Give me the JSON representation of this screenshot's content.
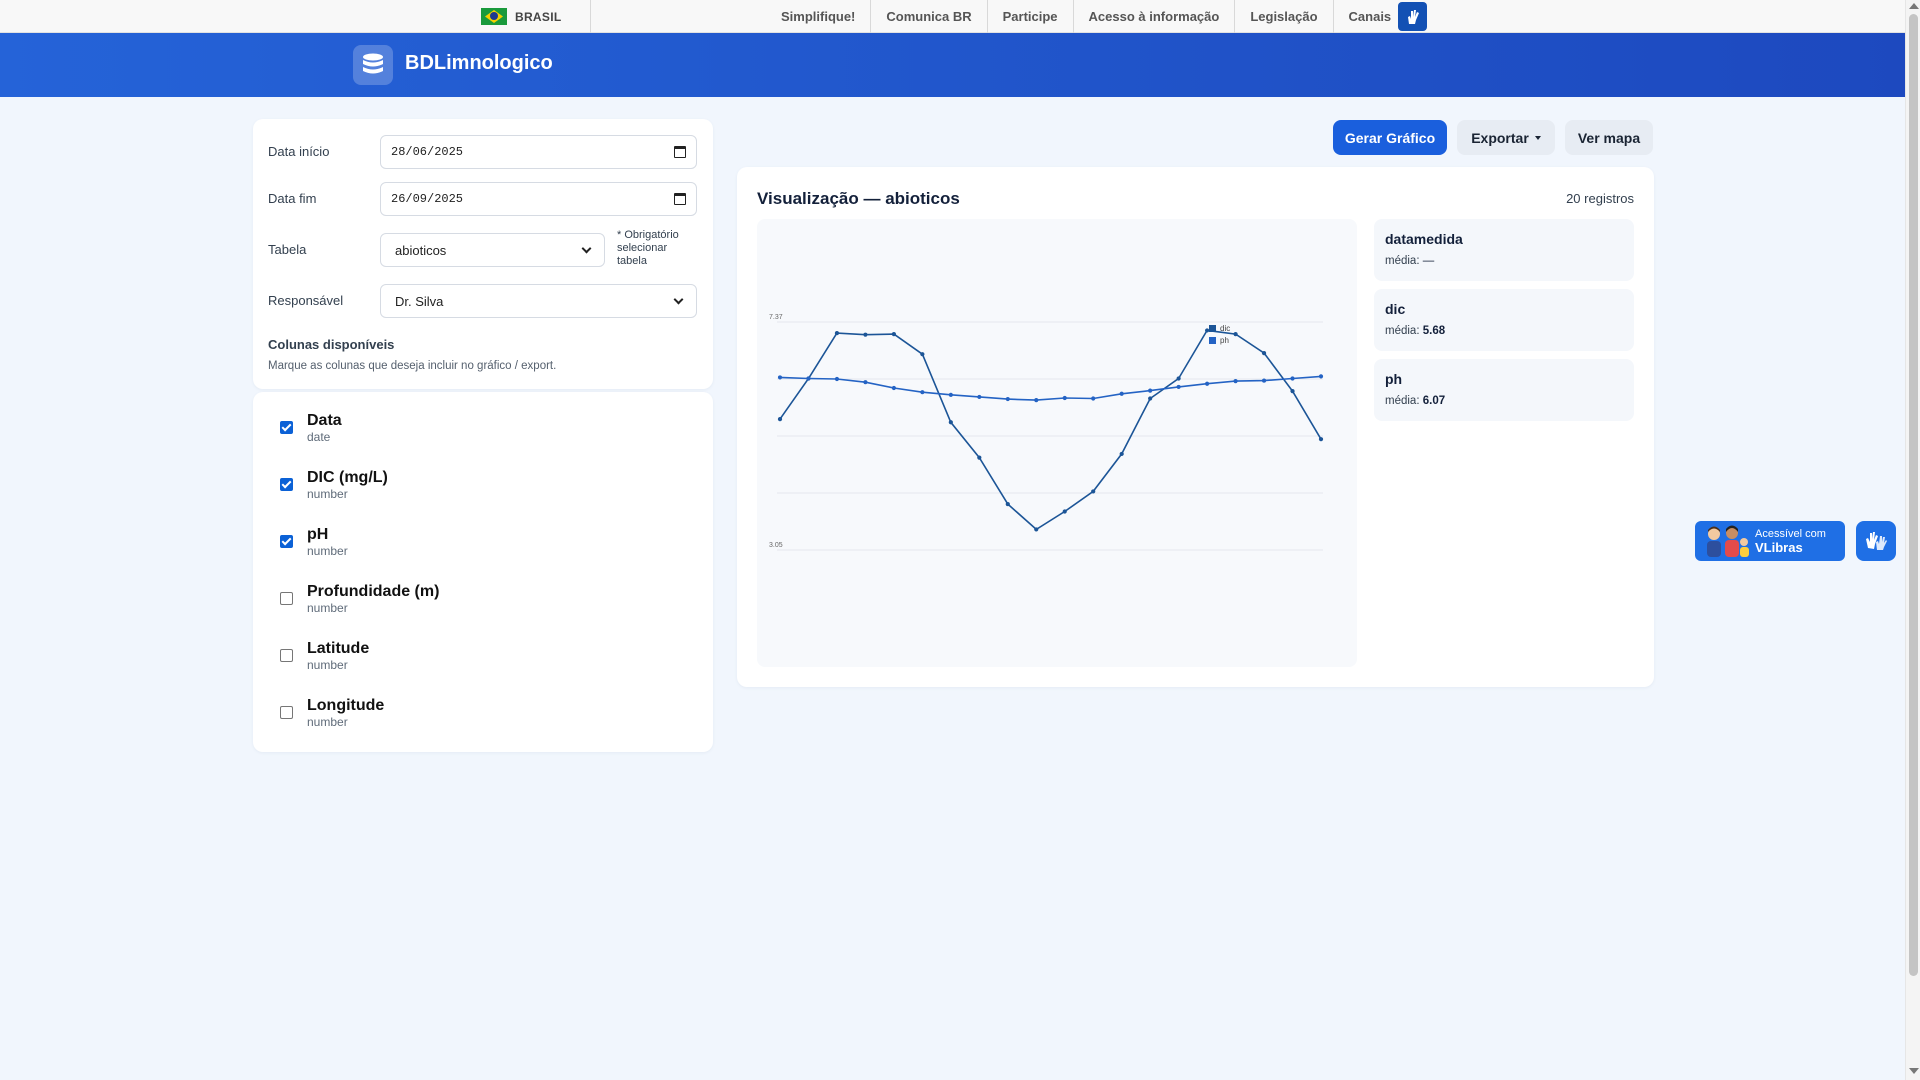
{
  "govbar": {
    "country": "BRASIL",
    "links": [
      "Simplifique!",
      "Comunica BR",
      "Participe",
      "Acesso à informação",
      "Legislação",
      "Canais"
    ]
  },
  "header": {
    "title": "BDLimnologico"
  },
  "filters": {
    "start_label": "Data início",
    "start_value": "28/06/2025",
    "end_label": "Data fim",
    "end_value": "26/09/2025",
    "table_label": "Tabela",
    "table_value": "abioticos",
    "required_note": "* Obrigatório selecionar tabela",
    "responsible_label": "Responsável",
    "responsible_value": "Dr. Silva",
    "columns_title": "Colunas disponíveis",
    "columns_subtitle": "Marque as colunas que deseja incluir no gráfico / export."
  },
  "columns": [
    {
      "name": "Data",
      "type": "date",
      "checked": true
    },
    {
      "name": "DIC (mg/L)",
      "type": "number",
      "checked": true
    },
    {
      "name": "pH",
      "type": "number",
      "checked": true
    },
    {
      "name": "Profundidade (m)",
      "type": "number",
      "checked": false
    },
    {
      "name": "Latitude",
      "type": "number",
      "checked": false
    },
    {
      "name": "Longitude",
      "type": "number",
      "checked": false
    }
  ],
  "toolbar": {
    "generate": "Gerar Gráfico",
    "export": "Exportar",
    "map": "Ver mapa"
  },
  "chart_panel": {
    "title": "Visualização — abioticos",
    "count": "20 registros",
    "stats": [
      {
        "name": "datamedida",
        "label": "média:",
        "value": "—"
      },
      {
        "name": "dic",
        "label": "média:",
        "value": "5.68"
      },
      {
        "name": "ph",
        "label": "média:",
        "value": "6.07"
      }
    ]
  },
  "chart_data": {
    "type": "line",
    "title": "",
    "xlabel": "",
    "ylabel": "",
    "ylim": [
      3.05,
      7.37
    ],
    "ytick_labels": [
      "7.37",
      "3.05"
    ],
    "x": [
      1,
      2,
      3,
      4,
      5,
      6,
      7,
      8,
      9,
      10,
      11,
      12,
      13,
      14,
      15,
      16,
      17,
      18,
      19,
      20
    ],
    "series": [
      {
        "name": "dic",
        "color": "#1c5597",
        "values": [
          5.53,
          6.3,
          7.16,
          7.13,
          7.14,
          6.76,
          5.47,
          4.8,
          3.92,
          3.44,
          3.78,
          4.16,
          4.87,
          5.92,
          6.3,
          7.21,
          7.14,
          6.78,
          6.06,
          5.15
        ]
      },
      {
        "name": "ph",
        "color": "#2463c4",
        "values": [
          6.32,
          6.3,
          6.29,
          6.23,
          6.12,
          6.04,
          5.99,
          5.95,
          5.91,
          5.89,
          5.93,
          5.92,
          6.01,
          6.07,
          6.14,
          6.2,
          6.25,
          6.26,
          6.3,
          6.34
        ]
      }
    ],
    "legend": "top-right",
    "grid": true
  },
  "vlibras": {
    "top": "Acessível com",
    "bottom": "VLibras"
  },
  "colors": {
    "primary": "#1a5fdd",
    "header_from": "#2563d8",
    "header_to": "#1d49bf",
    "checkbox": "#0b61d6"
  }
}
